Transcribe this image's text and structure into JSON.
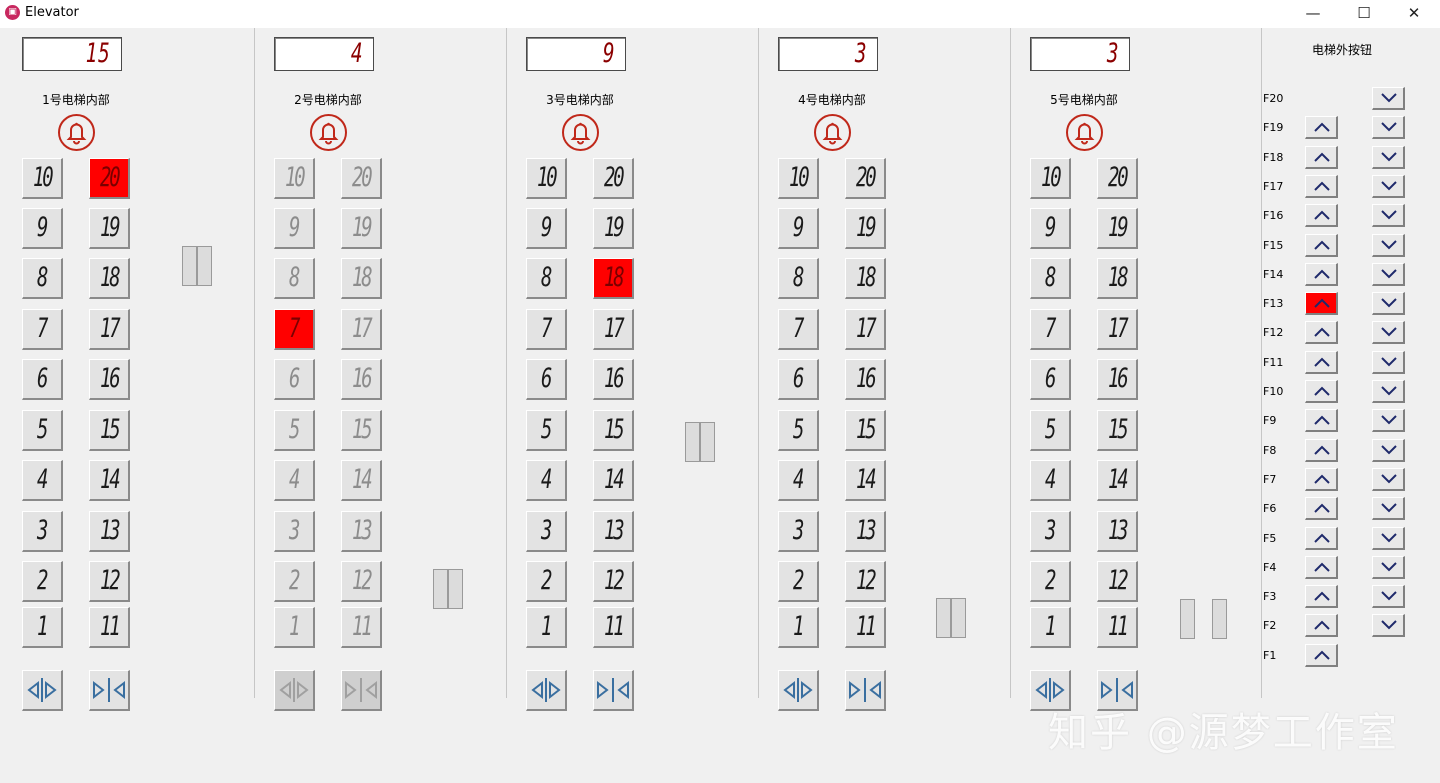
{
  "window": {
    "title": "Elevator",
    "minimize": "—",
    "maximize": "☐",
    "close": "✕"
  },
  "elevators": [
    {
      "display": "15",
      "label": "1号电梯内部",
      "lit": [
        20
      ],
      "disabled": false
    },
    {
      "display": "4",
      "label": "2号电梯内部",
      "lit": [
        7
      ],
      "disabled": true
    },
    {
      "display": "9",
      "label": "3号电梯内部",
      "lit": [
        18
      ],
      "disabled": false
    },
    {
      "display": "3",
      "label": "4号电梯内部",
      "lit": [],
      "disabled": false
    },
    {
      "display": "3",
      "label": "5号电梯内部",
      "lit": [],
      "disabled": false
    }
  ],
  "outer_panel": {
    "title": "电梯外按钮",
    "floors": [
      "F20",
      "F19",
      "F18",
      "F17",
      "F16",
      "F15",
      "F14",
      "F13",
      "F12",
      "F11",
      "F10",
      "F9",
      "F8",
      "F7",
      "F6",
      "F5",
      "F4",
      "F3",
      "F2",
      "F1"
    ],
    "lit_up": [
      "F13"
    ],
    "lit_down": []
  },
  "icons": {
    "bell": "bell-icon",
    "door_open": "door-open-icon",
    "door_close": "door-close-icon",
    "up": "chevron-up-icon",
    "down": "chevron-down-icon"
  },
  "colors": {
    "lit": "#ff0000",
    "bell": "#c0281a",
    "chevron": "#1f2a6b"
  },
  "watermark": "知乎 @源梦工作室"
}
